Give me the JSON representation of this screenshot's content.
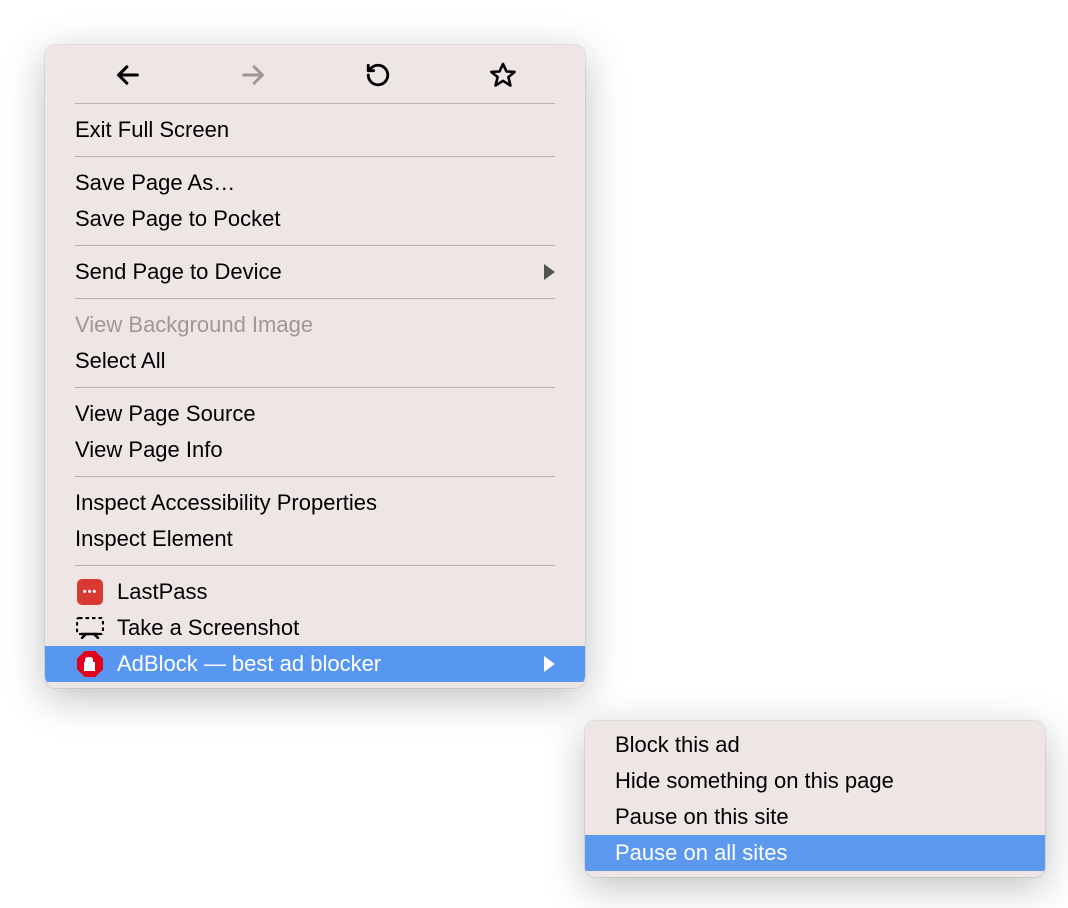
{
  "context_menu": {
    "nav_icons": [
      "back",
      "forward",
      "reload",
      "bookmark"
    ],
    "groups": [
      {
        "items": [
          {
            "id": "exit-fullscreen",
            "label": "Exit Full Screen"
          }
        ]
      },
      {
        "items": [
          {
            "id": "save-page-as",
            "label": "Save Page As…"
          },
          {
            "id": "save-to-pocket",
            "label": "Save Page to Pocket"
          }
        ]
      },
      {
        "items": [
          {
            "id": "send-to-device",
            "label": "Send Page to Device",
            "has_submenu": true
          }
        ]
      },
      {
        "items": [
          {
            "id": "view-bg-image",
            "label": "View Background Image",
            "disabled": true
          },
          {
            "id": "select-all",
            "label": "Select All"
          }
        ]
      },
      {
        "items": [
          {
            "id": "view-page-source",
            "label": "View Page Source"
          },
          {
            "id": "view-page-info",
            "label": "View Page Info"
          }
        ]
      },
      {
        "items": [
          {
            "id": "inspect-a11y",
            "label": "Inspect Accessibility Properties"
          },
          {
            "id": "inspect-element",
            "label": "Inspect Element"
          }
        ]
      },
      {
        "items": [
          {
            "id": "lastpass",
            "label": "LastPass",
            "icon": "lastpass"
          },
          {
            "id": "take-screenshot",
            "label": "Take a Screenshot",
            "icon": "screenshot"
          },
          {
            "id": "adblock",
            "label": "AdBlock — best ad blocker",
            "icon": "adblock",
            "has_submenu": true,
            "highlighted": true
          }
        ]
      }
    ]
  },
  "adblock_submenu": {
    "items": [
      {
        "id": "block-this-ad",
        "label": "Block this ad"
      },
      {
        "id": "hide-something",
        "label": "Hide something on this page"
      },
      {
        "id": "pause-this-site",
        "label": "Pause on this site"
      },
      {
        "id": "pause-all-sites",
        "label": "Pause on all sites",
        "highlighted": true
      }
    ]
  }
}
